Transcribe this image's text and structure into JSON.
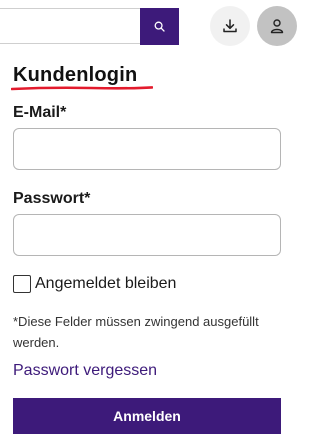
{
  "header": {
    "search": {
      "value": "",
      "placeholder": "",
      "icon": "search-icon"
    },
    "download_icon": "download-icon",
    "account_icon": "user-icon"
  },
  "login": {
    "title": "Kundenlogin",
    "email_label": "E-Mail*",
    "email_value": "",
    "password_label": "Passwort*",
    "password_value": "",
    "remember_label": "Angemeldet bleiben",
    "remember_checked": false,
    "required_note": "*Diese Felder müssen zwingend ausgefüllt werden.",
    "forgot_link": "Passwort vergessen",
    "submit_label": "Anmelden"
  },
  "colors": {
    "brand_purple": "#3d1a7a",
    "title_underline": "#e31b2d",
    "download_button_bg": "#f1f1f1",
    "account_button_bg": "#c2c2c2",
    "field_border": "#b5b5b5"
  }
}
